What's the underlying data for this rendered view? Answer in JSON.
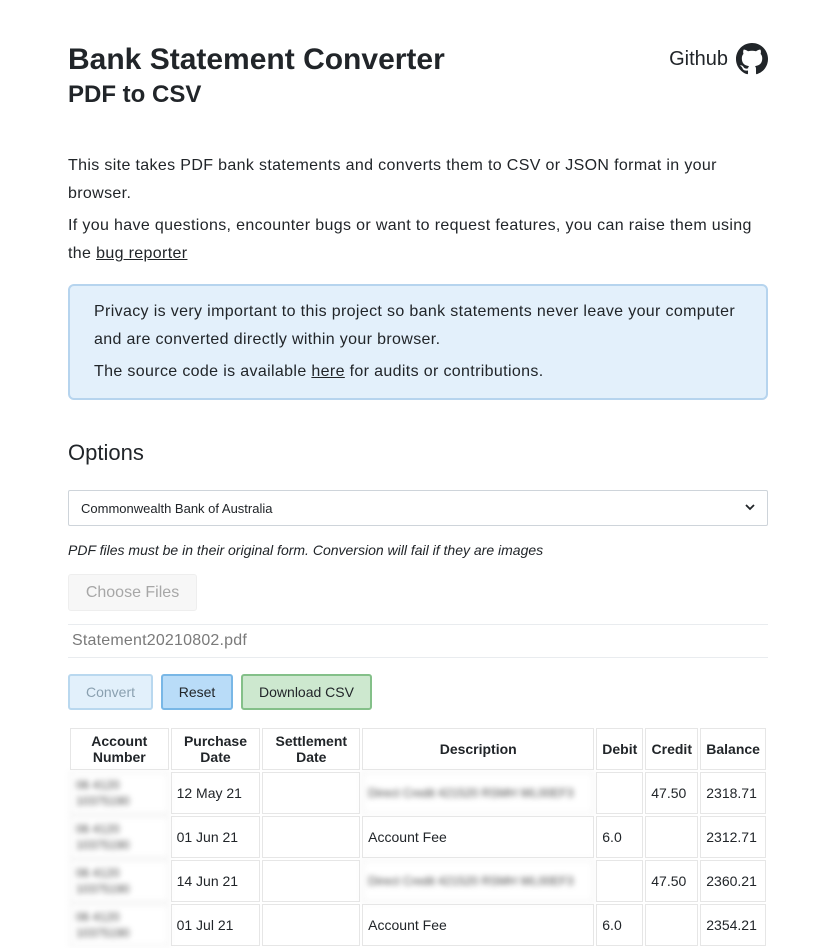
{
  "header": {
    "title": "Bank Statement Converter",
    "subtitle": "PDF to CSV",
    "github_label": "Github"
  },
  "intro": {
    "line1": "This site takes PDF bank statements and converts them to CSV or JSON format in your browser.",
    "line2_prefix": "If you have questions, encounter bugs or want to request features, you can raise them using the ",
    "bug_link": "bug reporter"
  },
  "notice": {
    "line1": "Privacy is very important to this project so bank statements never leave your computer and are converted directly within your browser.",
    "line2_prefix": "The source code is available ",
    "here_link": "here",
    "line2_suffix": " for audits or contributions."
  },
  "options": {
    "heading": "Options",
    "bank_selected": "Commonwealth Bank of Australia",
    "hint": "PDF files must be in their original form. Conversion will fail if they are images",
    "choose_files_label": "Choose Files",
    "file_name": "Statement20210802.pdf"
  },
  "actions": {
    "convert": "Convert",
    "reset": "Reset",
    "download_csv": "Download CSV"
  },
  "table": {
    "headers": {
      "account": "Account Number",
      "purchase": "Purchase Date",
      "settlement": "Settlement Date",
      "description": "Description",
      "debit": "Debit",
      "credit": "Credit",
      "balance": "Balance"
    },
    "rows": [
      {
        "account": "06 4120 10375190",
        "purchase": "12 May 21",
        "settlement": "",
        "description": "Direct Credit 421520 RSMH WL00EF3",
        "description_blurred": true,
        "debit": "",
        "credit": "47.50",
        "balance": "2318.71"
      },
      {
        "account": "06 4120 10375190",
        "purchase": "01 Jun 21",
        "settlement": "",
        "description": "Account Fee",
        "description_blurred": false,
        "debit": "6.0",
        "credit": "",
        "balance": "2312.71"
      },
      {
        "account": "06 4120 10375190",
        "purchase": "14 Jun 21",
        "settlement": "",
        "description": "Direct Credit 421520 RSMH WL00EF3",
        "description_blurred": true,
        "debit": "",
        "credit": "47.50",
        "balance": "2360.21"
      },
      {
        "account": "06 4120 10375190",
        "purchase": "01 Jul 21",
        "settlement": "",
        "description": "Account Fee",
        "description_blurred": false,
        "debit": "6.0",
        "credit": "",
        "balance": "2354.21"
      }
    ]
  }
}
